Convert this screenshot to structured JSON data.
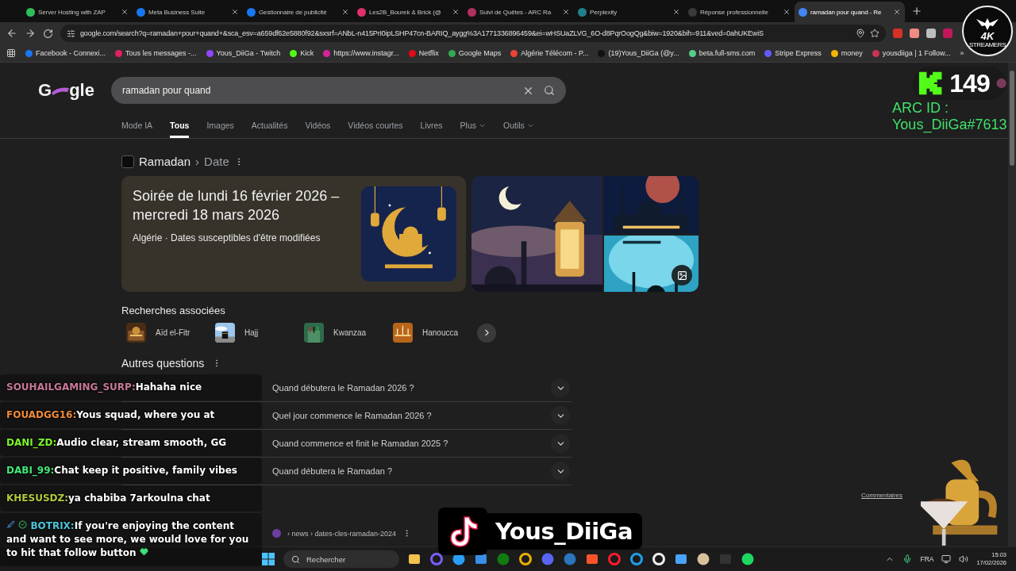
{
  "browser": {
    "tabs": [
      {
        "title": "Server Hosting with ZAP",
        "selected": false
      },
      {
        "title": "Meta Business Suite",
        "selected": false
      },
      {
        "title": "Gestionnaire de publicité",
        "selected": false
      },
      {
        "title": "Les2B_Bourek & Brick (@",
        "selected": false
      },
      {
        "title": "Suivi de Quêtes - ARC Ra",
        "selected": false
      },
      {
        "title": "Perplexity",
        "selected": false
      },
      {
        "title": "Réponse professionnelle",
        "selected": false
      },
      {
        "title": "ramadan pour quand - Re",
        "selected": true
      }
    ],
    "address": "google.com/search?q=ramadan+pour+quand+&sca_esv=a659df62e5880f92&sxsrf=ANbL-n415PrI0ipLSHP47cn-BARIQ_aygg%3A1771336896459&ei=wHSUaZLVG_6O-d8PqrOogQg&biw=1920&bih=911&ved=0ahUKEwiS",
    "bookmarks": [
      {
        "label": "Facebook - Connexi..."
      },
      {
        "label": "Tous les messages -..."
      },
      {
        "label": "Yous_DiiGa - Twitch"
      },
      {
        "label": "Kick"
      },
      {
        "label": "https://www.instagr..."
      },
      {
        "label": "Netflix"
      },
      {
        "label": "Google Maps"
      },
      {
        "label": "Algérie Télécom - P..."
      },
      {
        "label": "(19)Yous_DiiGa (@y..."
      },
      {
        "label": "beta.full-sms.com"
      },
      {
        "label": "Stripe Express"
      },
      {
        "label": "money"
      },
      {
        "label": "yousdiiga | 1 Follow..."
      }
    ],
    "bookmarks_more": "»"
  },
  "google": {
    "logo": [
      "G",
      "gle"
    ],
    "query": "ramadan pour quand",
    "nav": [
      {
        "label": "Mode IA",
        "selected": false,
        "kind": "link"
      },
      {
        "label": "Tous",
        "selected": true,
        "kind": "link"
      },
      {
        "label": "Images",
        "selected": false,
        "kind": "link"
      },
      {
        "label": "Actualités",
        "selected": false,
        "kind": "link"
      },
      {
        "label": "Vidéos",
        "selected": false,
        "kind": "link"
      },
      {
        "label": "Vidéos courtes",
        "selected": false,
        "kind": "link"
      },
      {
        "label": "Livres",
        "selected": false,
        "kind": "link"
      },
      {
        "label": "Plus",
        "selected": false,
        "kind": "menu"
      },
      {
        "label": "Outils",
        "selected": false,
        "kind": "menu"
      }
    ]
  },
  "answer": {
    "breadcrumb": [
      "Ramadan",
      "Date"
    ],
    "separator": "›",
    "title": "Soirée de lundi 16 février 2026 – mercredi 18 mars 2026",
    "subtitle": "Algérie · Dates susceptibles d'être modifiées"
  },
  "related": {
    "title": "Recherches associées",
    "items": [
      {
        "label": "Aïd el-Fitr"
      },
      {
        "label": "Hajj"
      },
      {
        "label": "Kwanzaa"
      },
      {
        "label": "Hanoucca"
      }
    ]
  },
  "questions": {
    "title": "Autres questions",
    "items": [
      {
        "text": "Quand débutera le Ramadan 2026 ?",
        "expanded": false
      },
      {
        "text": "Quel jour commence le Ramadan 2026 ?",
        "expanded": false
      },
      {
        "text": "Quand commence et finit le Ramadan 2025 ?",
        "expanded": false
      },
      {
        "text": "Quand débutera le Ramadan ?",
        "expanded": false
      }
    ],
    "feedback": "Commentaires"
  },
  "result": {
    "url": "› news › dates-cles-ramadan-2024"
  },
  "chat": [
    {
      "kind": "user",
      "user": "SOUHAILGAMING_SURP:",
      "color": "#c8789a",
      "text": "Hahaha nice"
    },
    {
      "kind": "user",
      "user": "FOUADGG16:",
      "color": "#f08a3a",
      "text": "Yous squad, where you at"
    },
    {
      "kind": "user",
      "user": "DANI_ZD:",
      "color": "#7cf52a",
      "text": "Audio clear, stream smooth, GG"
    },
    {
      "kind": "user",
      "user": "DABI_99:",
      "color": "#44e878",
      "text": "Chat keep it positive, family vibes"
    },
    {
      "kind": "user",
      "user": "KHESUSDZ:",
      "color": "#b4c83c",
      "text": "ya chabiba 7arkoulna chat"
    },
    {
      "kind": "bot",
      "user": "BOTRIX:",
      "color": "#4cc4d8",
      "text": "If you're enjoying the content and want to see more, we would love for you to hit that follow button"
    }
  ],
  "tiktok": {
    "name": "Yous_DiiGa"
  },
  "kick": {
    "count": "149"
  },
  "arc_id": {
    "label": "ARC ID :",
    "value": "Yous_DiiGa#7613"
  },
  "badge_logo": {
    "title": "4K",
    "subtitle": "STREAMERS"
  },
  "taskbar": {
    "search_placeholder": "Rechercher",
    "language": "FRA",
    "time": "15:03",
    "date": "17/02/2026"
  }
}
